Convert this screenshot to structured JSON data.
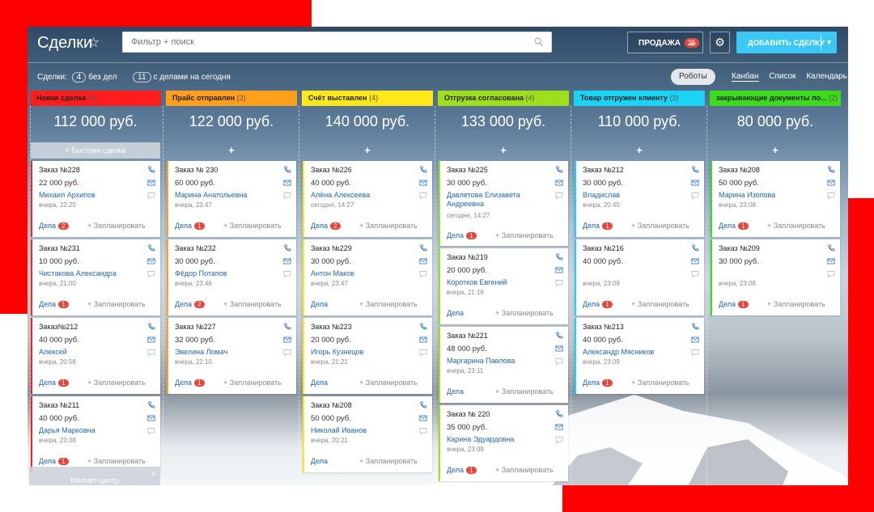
{
  "header": {
    "title": "Сделки",
    "search_placeholder": "Фильтр + поиск",
    "pipeline_label": "ПРОДАЖА",
    "pipeline_count": "25",
    "add_button": "ДОБАВИТЬ СДЕЛКУ"
  },
  "subbar": {
    "deals_label": "Сделки:",
    "no_tasks_count": "4",
    "no_tasks_label": "без дел",
    "today_count": "11",
    "today_label": "с делами на сегодня",
    "robots": "Роботы",
    "views": [
      "Канбан",
      "Список",
      "Календарь"
    ]
  },
  "common": {
    "deals": "Дела",
    "plan": "+ Запланировать",
    "quick_deal": "+ Быстрая сделка",
    "plus": "+",
    "contact_center": "Контакт-центр",
    "close": "×"
  },
  "columns": [
    {
      "name": "Новая сделка",
      "count": "(4)",
      "sum": "112 000 руб.",
      "color": "#ff1d1d",
      "cards": [
        {
          "title": "Заказ №228",
          "sum": "22 000 руб.",
          "contact": "Михаил Архипов",
          "time": "вчера, 22:25",
          "deals": "2"
        },
        {
          "title": "Заказ №231",
          "sum": "10 000 руб.",
          "contact": "Чистакова Александра",
          "time": "вчера, 21:00",
          "deals": "1"
        },
        {
          "title": "Заказ№212",
          "sum": "40 000 руб.",
          "contact": "Алексей",
          "time": "вчера, 20:58",
          "deals": "1"
        },
        {
          "title": "Заказ №211",
          "sum": "40 000 руб.",
          "contact": "Дарья Марковна",
          "time": "вчера, 23:08",
          "deals": "1"
        }
      ]
    },
    {
      "name": "Прайс отправлен",
      "count": "(3)",
      "sum": "122 000 руб.",
      "color": "#ff9f1a",
      "cards": [
        {
          "title": "Заказ № 230",
          "sum": "60 000 руб.",
          "contact": "Марина Анатольевна",
          "time": "вчера, 23:47",
          "deals": "1"
        },
        {
          "title": "Заказ №232",
          "sum": "30 000 руб.",
          "contact": "Фёдор Потапов",
          "time": "вчера, 23:46",
          "deals": "2"
        },
        {
          "title": "Заказ №227",
          "sum": "32 000 руб.",
          "contact": "Эвелина Ломач",
          "time": "вчера, 22:10",
          "deals": "1"
        }
      ]
    },
    {
      "name": "Счёт выставлен",
      "count": "(4)",
      "sum": "140 000 руб.",
      "color": "#ffe81a",
      "cards": [
        {
          "title": "Заказ №226",
          "sum": "40 000 руб.",
          "contact": "Алёна Алексеева",
          "time": "сегодня, 14:27",
          "deals": "2"
        },
        {
          "title": "Заказ №229",
          "sum": "30 000 руб.",
          "contact": "Антон Маков",
          "time": "вчера, 23:47",
          "deals": ""
        },
        {
          "title": "Заказ №223",
          "sum": "20 000 руб.",
          "contact": "Игорь Кузнецов",
          "time": "вчера, 21:21",
          "deals": ""
        },
        {
          "title": "Заказ №208",
          "sum": "50 000 руб.",
          "contact": "Николай Иванов",
          "time": "вчера, 20:21",
          "deals": ""
        }
      ]
    },
    {
      "name": "Отгрузка согласована",
      "count": "(4)",
      "sum": "133 000 руб.",
      "color": "#9fde1a",
      "cards": [
        {
          "title": "Заказ №225",
          "sum": "30 000 руб.",
          "contact": "Давлетова Елизавета Андреевна",
          "time": "сегодня, 14:27",
          "deals": "1"
        },
        {
          "title": "Заказ №219",
          "sum": "20 000 руб.",
          "contact": "Коротков Евгений",
          "time": "вчера, 21:16",
          "deals": ""
        },
        {
          "title": "Заказ №221",
          "sum": "48 000 руб.",
          "contact": "Маргарина Павлова",
          "time": "вчера, 23:11",
          "deals": ""
        },
        {
          "title": "Заказ № 220",
          "sum": "35 000 руб.",
          "contact": "Карина Эдуардовна",
          "time": "вчера, 23:09",
          "deals": "1"
        }
      ]
    },
    {
      "name": "Товар отгружен клиенту",
      "count": "(3)",
      "sum": "110 000 руб.",
      "color": "#1ad4f5",
      "cards": [
        {
          "title": "Заказ №212",
          "sum": "30 000 руб.",
          "contact": "Владислав",
          "time": "вчера, 20:45",
          "deals": "1"
        },
        {
          "title": "Заказ №216",
          "sum": "40 000 руб.",
          "contact": "",
          "time": "вчера, 23:09",
          "deals": "1"
        },
        {
          "title": "Заказ №213",
          "sum": "40 000 руб.",
          "contact": "Александр Мясников",
          "time": "вчера, 23:09",
          "deals": "1"
        }
      ]
    },
    {
      "name": "закрывающие документы по...",
      "count": "(2)",
      "sum": "80 000 руб.",
      "color": "#3ddc1a",
      "cards": [
        {
          "title": "Заказ №208",
          "sum": "50 000 руб.",
          "contact": "Марина Изопова",
          "time": "вчера, 23:08",
          "deals": "1"
        },
        {
          "title": "Заказ №209",
          "sum": "30 000 руб.",
          "contact": "",
          "time": "вчера, 23:08",
          "deals": "1"
        }
      ]
    }
  ]
}
